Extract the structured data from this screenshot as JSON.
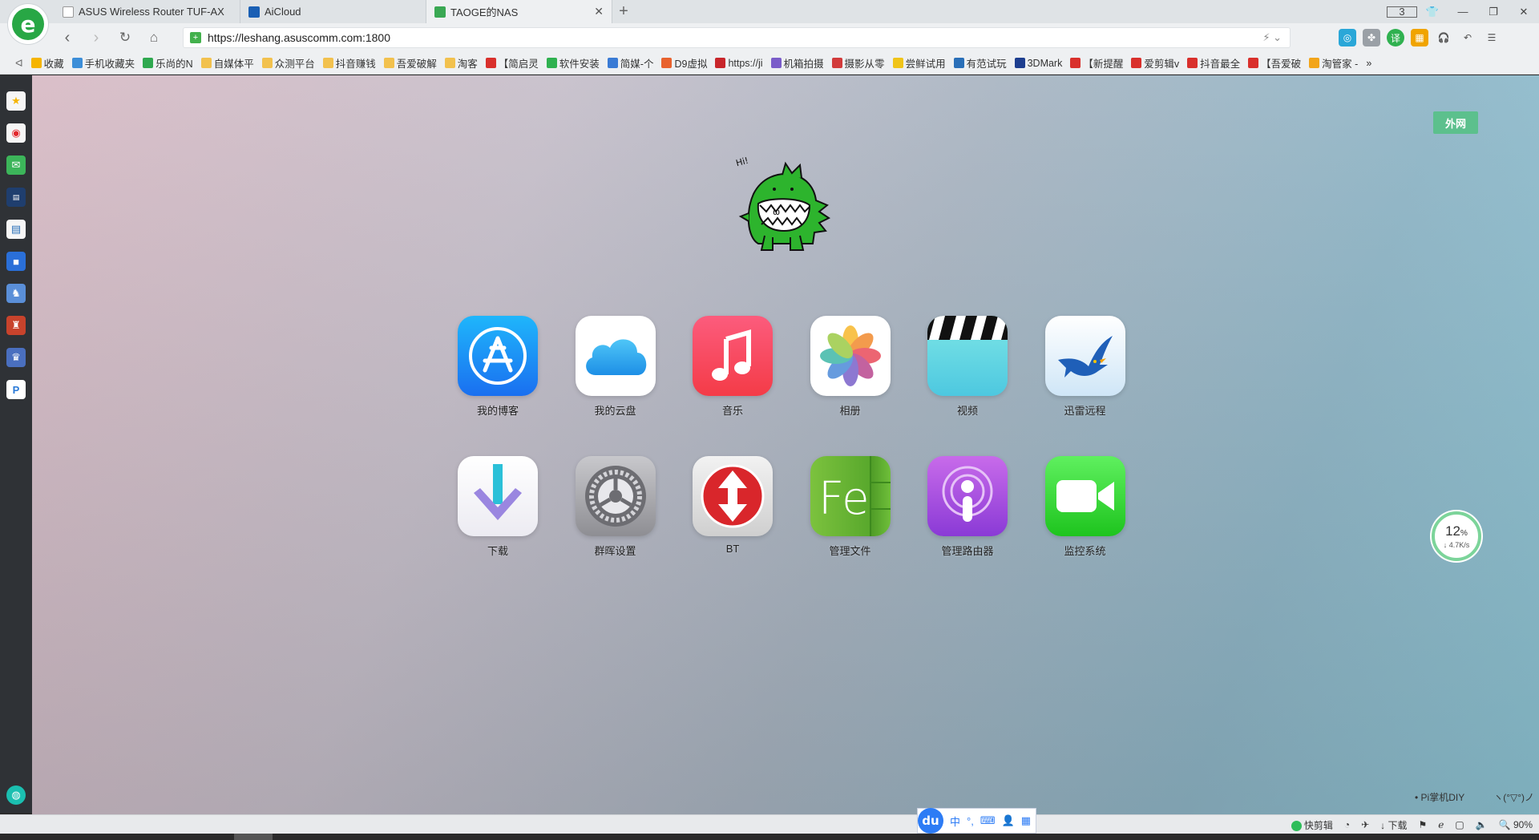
{
  "browser": {
    "tabs": [
      {
        "title": "ASUS Wireless Router TUF-AX",
        "active": false
      },
      {
        "title": "AiCloud",
        "active": false
      },
      {
        "title": "TAOGE的NAS",
        "active": true
      }
    ],
    "tab_count": "3",
    "address": "https://leshang.asuscomm.com:1800",
    "bookmarks": [
      {
        "label": "收藏",
        "color": "#f5b400"
      },
      {
        "label": "手机收藏夹",
        "color": "#3c8ed8"
      },
      {
        "label": "乐尚的N",
        "color": "#2fa84f"
      },
      {
        "label": "自媒体平",
        "color": "#f2c14e"
      },
      {
        "label": "众测平台",
        "color": "#f2c14e"
      },
      {
        "label": "抖音赚钱",
        "color": "#f2c14e"
      },
      {
        "label": "吾爱破解",
        "color": "#f2c14e"
      },
      {
        "label": "淘客",
        "color": "#f2c14e"
      },
      {
        "label": "【简启灵",
        "color": "#d9302c"
      },
      {
        "label": "软件安装",
        "color": "#2fb150"
      },
      {
        "label": "简媒-个",
        "color": "#3a7bd5"
      },
      {
        "label": "D9虚拟",
        "color": "#e8622e"
      },
      {
        "label": "https://ji",
        "color": "#c8262b"
      },
      {
        "label": "机箱拍摄",
        "color": "#7a5cc9"
      },
      {
        "label": "摄影从零",
        "color": "#d23b3b"
      },
      {
        "label": "尝鲜试用",
        "color": "#f0c419"
      },
      {
        "label": "有范试玩",
        "color": "#2a6fb8"
      },
      {
        "label": "3DMark",
        "color": "#1d3e8f"
      },
      {
        "label": "【新提醒",
        "color": "#d9302c"
      },
      {
        "label": "爱剪辑v",
        "color": "#d9302c"
      },
      {
        "label": "抖音最全",
        "color": "#d9302c"
      },
      {
        "label": "【吾爱破",
        "color": "#d9302c"
      },
      {
        "label": "淘管家 -",
        "color": "#f2a51a"
      }
    ],
    "bookmarks_more": "»"
  },
  "page": {
    "outer_net_button": "外网",
    "apps": [
      {
        "label": "我的博客",
        "icon": "app-store-icon"
      },
      {
        "label": "我的云盘",
        "icon": "cloud-icon"
      },
      {
        "label": "音乐",
        "icon": "music-note-icon"
      },
      {
        "label": "相册",
        "icon": "photos-flower-icon"
      },
      {
        "label": "视频",
        "icon": "clapperboard-icon"
      },
      {
        "label": "迅雷远程",
        "icon": "bird-icon"
      },
      {
        "label": "下载",
        "icon": "download-arrow-icon"
      },
      {
        "label": "群晖设置",
        "icon": "settings-gear-icon"
      },
      {
        "label": "BT",
        "icon": "bt-arrows-icon"
      },
      {
        "label": "管理文件",
        "icon": "file-manager-icon"
      },
      {
        "label": "管理路由器",
        "icon": "podcast-icon"
      },
      {
        "label": "监控系统",
        "icon": "video-camera-icon"
      }
    ],
    "speed_percent": "12",
    "speed_percent_unit": "%",
    "speed_rate": "↓ 4.7K/s",
    "footer_left": "• Pi掌机DIY",
    "footer_right": "ヽ(°▽°)ノ"
  },
  "statusbar": {
    "kuaijian": "快剪辑",
    "download": "下载",
    "zoom": "90%"
  },
  "ime": {
    "logo": "du",
    "lang": "中"
  }
}
